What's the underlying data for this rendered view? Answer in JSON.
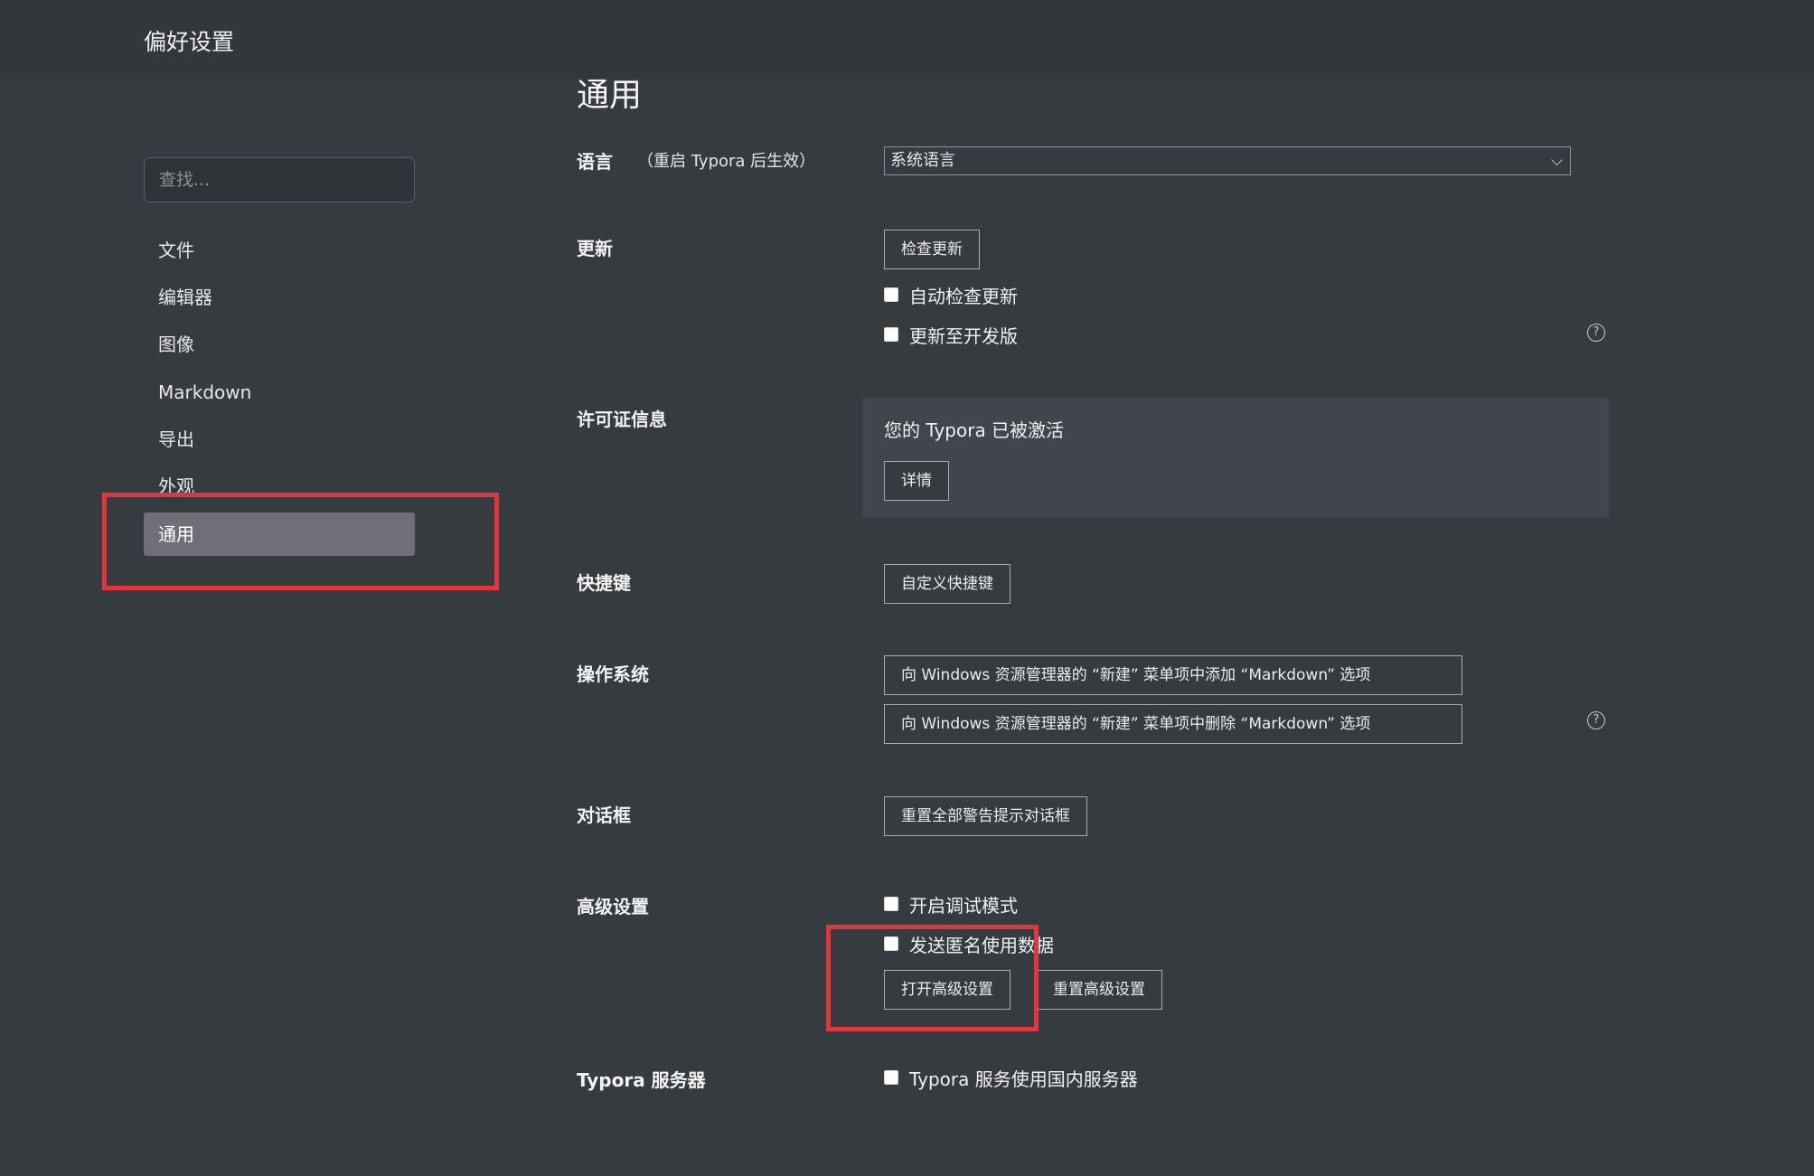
{
  "window": {
    "title": "偏好设置"
  },
  "sidebar": {
    "search_placeholder": "查找...",
    "items": [
      {
        "label": "文件"
      },
      {
        "label": "编辑器"
      },
      {
        "label": "图像"
      },
      {
        "label": "Markdown"
      },
      {
        "label": "导出"
      },
      {
        "label": "外观"
      },
      {
        "label": "通用",
        "active": true
      }
    ]
  },
  "main": {
    "heading": "通用",
    "language": {
      "label": "语言",
      "note": "（重启 Typora 后生效）",
      "selected": "系统语言"
    },
    "update": {
      "label": "更新",
      "check_button": "检查更新",
      "auto_check": {
        "label": "自动检查更新",
        "checked": false
      },
      "dev_channel": {
        "label": "更新至开发版",
        "checked": false
      }
    },
    "license": {
      "label": "许可证信息",
      "status": "您的 Typora 已被激活",
      "details_button": "详情"
    },
    "shortcuts": {
      "label": "快捷键",
      "customize_button": "自定义快捷键"
    },
    "os": {
      "label": "操作系统",
      "add_button": "向 Windows 资源管理器的 “新建” 菜单项中添加 “Markdown” 选项",
      "remove_button": "向 Windows 资源管理器的 “新建” 菜单项中删除 “Markdown” 选项"
    },
    "dialogs": {
      "label": "对话框",
      "reset_button": "重置全部警告提示对话框"
    },
    "advanced": {
      "label": "高级设置",
      "debug_mode": {
        "label": "开启调试模式",
        "checked": false
      },
      "anonymous_data": {
        "label": "发送匿名使用数据",
        "checked": false
      },
      "open_button": "打开高级设置",
      "reset_button": "重置高级设置"
    },
    "server": {
      "label": "Typora 服务器",
      "domestic": {
        "label": "Typora 服务使用国内服务器",
        "checked": false
      }
    }
  },
  "icons": {
    "help": "?",
    "chevron": "⌵"
  },
  "colors": {
    "background": "#363b40",
    "active_item": "#6e6f78",
    "highlight_border": "#e3343a"
  }
}
